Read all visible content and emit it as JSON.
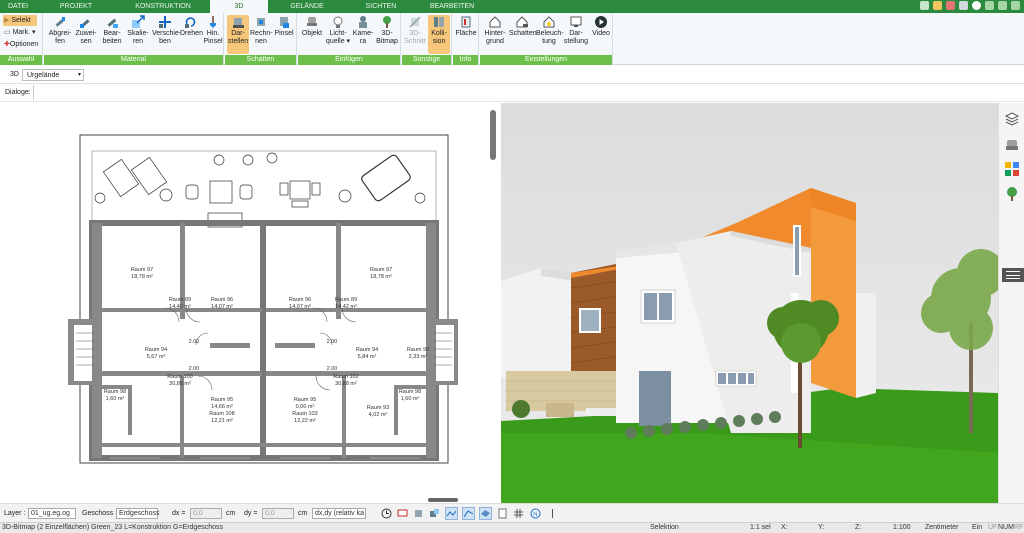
{
  "tabs": [
    {
      "label": "DATEI"
    },
    {
      "label": "PROJEKT"
    },
    {
      "label": "KONSTRUKTION"
    },
    {
      "label": "3D"
    },
    {
      "label": "GELÄNDE"
    },
    {
      "label": "SICHTEN"
    },
    {
      "label": "BEARBEITEN"
    }
  ],
  "ribbon": {
    "auswahl": {
      "label": "Auswahl",
      "selekt": "Selekt",
      "mark": "Mark.",
      "optionen": "Optionen"
    },
    "material": {
      "label": "Material",
      "buttons": [
        "Abgrei-\nfen",
        "Zuwei-\nsen",
        "Bear-\nbeiten",
        "Skalie-\nren",
        "Verschie-\nben",
        "Drehen",
        "Hin.\nPinsel"
      ]
    },
    "schatten": {
      "label": "Schatten",
      "buttons": [
        "Dar-\nstellen",
        "Rechn-\nnen",
        "Pinsel"
      ]
    },
    "einfuegen": {
      "label": "Einfügen",
      "buttons": [
        "Objekt",
        "Licht-\nquelle",
        "Kame-\nra",
        "3D-\nBitmap"
      ]
    },
    "sonstige": {
      "label": "Sonstige",
      "buttons": [
        "3D-\nSchnitt",
        "Kolli-\nsion"
      ]
    },
    "info": {
      "label": "Info",
      "buttons": [
        "Fläche"
      ]
    },
    "einstellungen": {
      "label": "Einstellungen",
      "buttons": [
        "Hinter-\ngrund",
        "Schatten",
        "Beleuch-\ntung",
        "Dar-\nstellung",
        "Video"
      ]
    }
  },
  "row2": {
    "view_label": "3D",
    "dropdown": "Urgelände"
  },
  "row3": {
    "dialog_label": "Dialoge:"
  },
  "plan": {
    "rooms": [
      {
        "name": "Raum 97",
        "area": "18,78 m²"
      },
      {
        "name": "Raum 97",
        "area": "18,78 m²"
      },
      {
        "name": "Raum 96",
        "area": "14,07 m²"
      },
      {
        "name": "Raum 96",
        "area": "14,07 m²"
      },
      {
        "name": "Raum 89",
        "area": "14,42 m²"
      },
      {
        "name": "Raum 89",
        "area": "14,42 m²"
      },
      {
        "name": "Raum 94",
        "area": "5,67 m²"
      },
      {
        "name": "Raum 94",
        "area": "5,84 m²"
      },
      {
        "name": "Raum 95",
        "area": "14,66 m²"
      },
      {
        "name": "Raum 95",
        "area": "0,00 m²"
      },
      {
        "name": "Raum 108",
        "area": "12,21 m²"
      },
      {
        "name": "Raum 103",
        "area": "12,22 m²"
      },
      {
        "name": "Raum 98",
        "area": "1,60 m²"
      },
      {
        "name": "Raum 98",
        "area": "1,60 m²"
      },
      {
        "name": "Raum 100",
        "area": "30,88 m²"
      },
      {
        "name": "Raum 102",
        "area": "30,88 m²"
      },
      {
        "name": "Raum 99",
        "area": "2,33 m²"
      },
      {
        "name": "Raum 93",
        "area": "4,02 m²"
      }
    ],
    "dims": [
      "2.00",
      "2.00",
      "2.00",
      "2.00"
    ]
  },
  "bottom": {
    "layer_label": "Layer :",
    "layer_value": "01_ug.eg.og",
    "geschoss_label": "Geschoss :",
    "geschoss_value": "Erdgeschoss",
    "dx_label": "dx =",
    "dx_value": "0,0",
    "dx_unit": "cm",
    "dy_label": "dy =",
    "dy_value": "0,0",
    "dy_unit": "cm",
    "mode_value": "dx,dy (relativ ka"
  },
  "status": {
    "message": "3D-Bitmap (2 Einzelflächen) Green_23 L=Konstruktion G=Erdgeschoss",
    "mode": "Selektion",
    "sel": "1:1 sel",
    "x": "X:",
    "y": "Y:",
    "z": "Z:",
    "scale": "1:100",
    "unit": "Zentimeter",
    "ein": "Ein",
    "uf": "UF",
    "num": "NUM",
    "rf": "RF"
  },
  "colors": {
    "tabbar": "#2b8a3e",
    "ribbon_group": "#6cc04a",
    "selected": "#f6c77b",
    "orange_wall": "#f08a2c"
  }
}
